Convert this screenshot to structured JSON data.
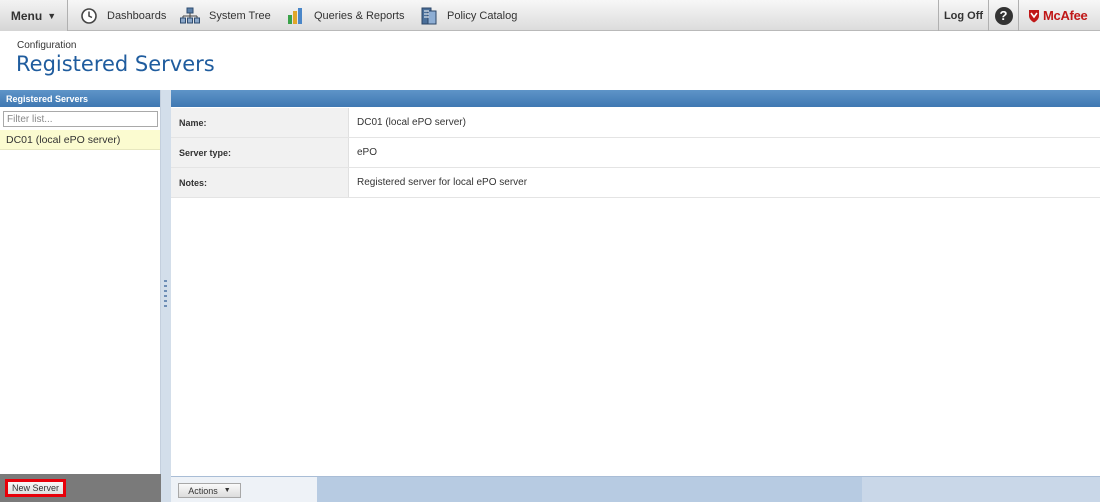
{
  "toolbar": {
    "menu_label": "Menu",
    "menu_arrow": "▼",
    "nav": [
      {
        "label": "Dashboards",
        "icon": "dashboard-clock-icon"
      },
      {
        "label": "System Tree",
        "icon": "system-tree-icon"
      },
      {
        "label": "Queries & Reports",
        "icon": "queries-reports-icon"
      },
      {
        "label": "Policy Catalog",
        "icon": "policy-catalog-icon"
      }
    ],
    "logoff_label": "Log Off",
    "help_label": "?",
    "brand": "McAfee"
  },
  "header": {
    "breadcrumb": "Configuration",
    "title": "Registered Servers"
  },
  "left_panel": {
    "title": "Registered Servers",
    "filter_placeholder": "Filter list...",
    "items": [
      "DC01 (local ePO server)"
    ],
    "new_server_label": "New Server"
  },
  "details": {
    "rows": [
      {
        "label": "Name:",
        "value": "DC01 (local ePO server)"
      },
      {
        "label": "Server type:",
        "value": "ePO"
      },
      {
        "label": "Notes:",
        "value": "Registered server for local ePO server"
      }
    ]
  },
  "bottom_bar": {
    "actions_label": "Actions",
    "actions_arrow": "▼"
  },
  "colors": {
    "title_blue": "#1f5c9e",
    "header_blue": "#4a82bc",
    "brand_red": "#c01818",
    "highlight_red": "#e8000a",
    "selected_item": "#fbfbd0"
  }
}
